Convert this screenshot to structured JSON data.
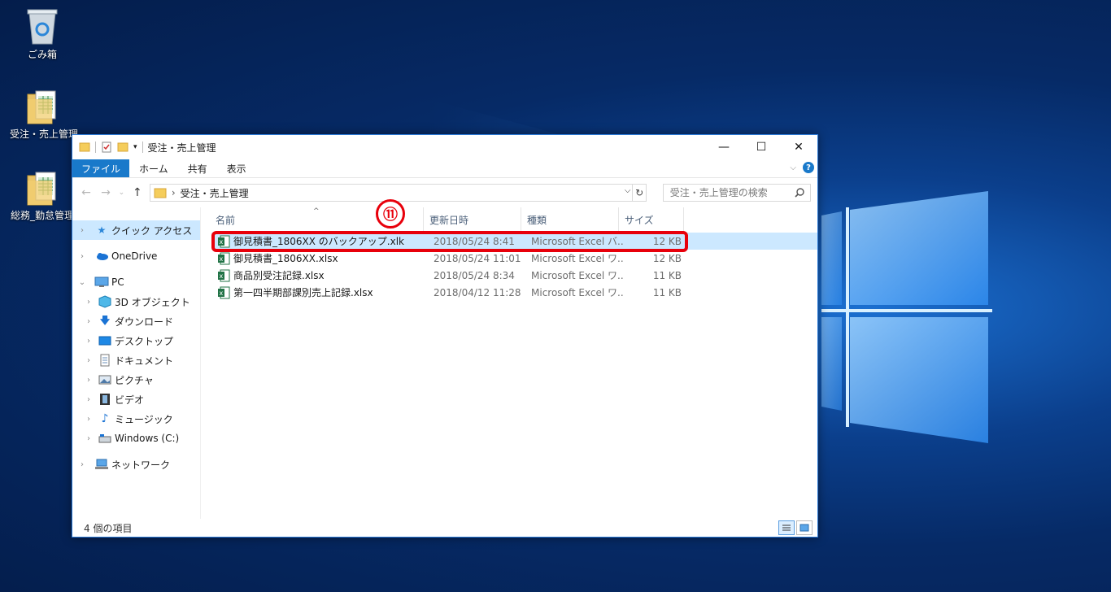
{
  "desktop": {
    "icons": [
      {
        "label": "ごみ箱",
        "icon": "recycle-bin-icon"
      },
      {
        "label": "受注・売上管理",
        "icon": "folder-icon"
      },
      {
        "label": "総務_勤怠管理",
        "icon": "folder-icon"
      }
    ]
  },
  "window": {
    "title": "受注・売上管理",
    "controls": {
      "minimize": "—",
      "maximize": "☐",
      "close": "✕"
    }
  },
  "ribbon": {
    "tabs": [
      "ファイル",
      "ホーム",
      "共有",
      "表示"
    ]
  },
  "address": {
    "path": "受注・売上管理",
    "search_placeholder": "受注・売上管理の検索"
  },
  "nav": {
    "items": [
      {
        "label": "クイック アクセス",
        "icon": "star-icon"
      },
      {
        "label": "OneDrive",
        "icon": "cloud-icon"
      },
      {
        "label": "PC",
        "icon": "computer-icon"
      },
      {
        "label": "3D オブジェクト",
        "icon": "cube-icon"
      },
      {
        "label": "ダウンロード",
        "icon": "download-icon"
      },
      {
        "label": "デスクトップ",
        "icon": "desktop-icon"
      },
      {
        "label": "ドキュメント",
        "icon": "document-icon"
      },
      {
        "label": "ピクチャ",
        "icon": "picture-icon"
      },
      {
        "label": "ビデオ",
        "icon": "video-icon"
      },
      {
        "label": "ミュージック",
        "icon": "music-icon"
      },
      {
        "label": "Windows (C:)",
        "icon": "drive-icon"
      },
      {
        "label": "ネットワーク",
        "icon": "network-icon"
      }
    ]
  },
  "columns": [
    "名前",
    "更新日時",
    "種類",
    "サイズ"
  ],
  "files": [
    {
      "name": "御見積書_1806XX のバックアップ.xlk",
      "modified": "2018/05/24 8:41",
      "type": "Microsoft Excel バ...",
      "size": "12 KB"
    },
    {
      "name": "御見積書_1806XX.xlsx",
      "modified": "2018/05/24 11:01",
      "type": "Microsoft Excel ワ...",
      "size": "12 KB"
    },
    {
      "name": "商品別受注記録.xlsx",
      "modified": "2018/05/24 8:34",
      "type": "Microsoft Excel ワ...",
      "size": "11 KB"
    },
    {
      "name": "第一四半期部課別売上記録.xlsx",
      "modified": "2018/04/12 11:28",
      "type": "Microsoft Excel ワ...",
      "size": "11 KB"
    }
  ],
  "annotation": {
    "step": "⑪",
    "color": "#e8000b"
  },
  "status": {
    "item_count": "4 個の項目"
  },
  "colors": {
    "accent": "#1979ca",
    "selection": "#cce8ff"
  }
}
